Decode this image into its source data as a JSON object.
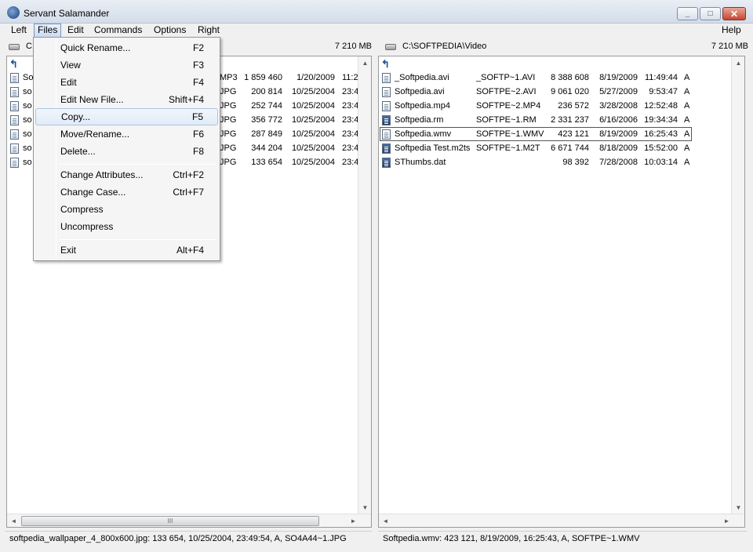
{
  "window": {
    "title": "Servant Salamander"
  },
  "menubar": {
    "items": [
      {
        "label": "Left",
        "name": "menu-left"
      },
      {
        "label": "Files",
        "name": "menu-files"
      },
      {
        "label": "Edit",
        "name": "menu-edit"
      },
      {
        "label": "Commands",
        "name": "menu-commands"
      },
      {
        "label": "Options",
        "name": "menu-options"
      },
      {
        "label": "Right",
        "name": "menu-right"
      },
      {
        "label": "Help",
        "name": "menu-help"
      }
    ]
  },
  "files_menu": {
    "items": [
      {
        "label": "Quick Rename...",
        "shortcut": "F2"
      },
      {
        "label": "View",
        "shortcut": "F3"
      },
      {
        "label": "Edit",
        "shortcut": "F4"
      },
      {
        "label": "Edit New File...",
        "shortcut": "Shift+F4"
      },
      {
        "label": "Copy...",
        "shortcut": "F5"
      },
      {
        "label": "Move/Rename...",
        "shortcut": "F6"
      },
      {
        "label": "Delete...",
        "shortcut": "F8"
      },
      {
        "label": "Change Attributes...",
        "shortcut": "Ctrl+F2"
      },
      {
        "label": "Change Case...",
        "shortcut": "Ctrl+F7"
      },
      {
        "label": "Compress",
        "shortcut": ""
      },
      {
        "label": "Uncompress",
        "shortcut": ""
      },
      {
        "label": "Exit",
        "shortcut": "Alt+F4"
      }
    ]
  },
  "left_panel": {
    "path": "C",
    "free_space": "7 210 MB",
    "status": "softpedia_wallpaper_4_800x600.jpg: 133 654, 10/25/2004, 23:49:54, A, SO4A44~1.JPG",
    "files": [
      {
        "name": "So",
        "ext": "MP3",
        "size": "1 859 460",
        "date": "1/20/2009",
        "time": "11:2"
      },
      {
        "name": "so",
        "ext": "JPG",
        "size": "200 814",
        "date": "10/25/2004",
        "time": "23:4"
      },
      {
        "name": "so",
        "ext": "JPG",
        "size": "252 744",
        "date": "10/25/2004",
        "time": "23:4"
      },
      {
        "name": "so",
        "ext": "JPG",
        "size": "356 772",
        "date": "10/25/2004",
        "time": "23:4"
      },
      {
        "name": "so",
        "ext": "JPG",
        "size": "287 849",
        "date": "10/25/2004",
        "time": "23:4"
      },
      {
        "name": "so",
        "ext": "JPG",
        "size": "344 204",
        "date": "10/25/2004",
        "time": "23:4"
      },
      {
        "name": "so",
        "ext": "JPG",
        "size": "133 654",
        "date": "10/25/2004",
        "time": "23:4"
      }
    ]
  },
  "right_panel": {
    "path": "C:\\SOFTPEDIA\\Video",
    "free_space": "7 210 MB",
    "status": "Softpedia.wmv: 423 121, 8/19/2009, 16:25:43, A, SOFTPE~1.WMV",
    "files": [
      {
        "name": "_Softpedia.avi",
        "dos": "_SOFTP~1.AVI",
        "size": "8 388 608",
        "date": "8/19/2009",
        "time": "11:49:44",
        "attr": "A",
        "icon": "doc"
      },
      {
        "name": "Softpedia.avi",
        "dos": "SOFTPE~2.AVI",
        "size": "9 061 020",
        "date": "5/27/2009",
        "time": "9:53:47",
        "attr": "A",
        "icon": "doc"
      },
      {
        "name": "Softpedia.mp4",
        "dos": "SOFTPE~2.MP4",
        "size": "236 572",
        "date": "3/28/2008",
        "time": "12:52:48",
        "attr": "A",
        "icon": "doc"
      },
      {
        "name": "Softpedia.rm",
        "dos": "SOFTPE~1.RM",
        "size": "2 331 237",
        "date": "6/16/2006",
        "time": "19:34:34",
        "attr": "A",
        "icon": "media"
      },
      {
        "name": "Softpedia.wmv",
        "dos": "SOFTPE~1.WMV",
        "size": "423 121",
        "date": "8/19/2009",
        "time": "16:25:43",
        "attr": "A",
        "icon": "doc"
      },
      {
        "name": "Softpedia Test.m2ts",
        "dos": "SOFTPE~1.M2T",
        "size": "6 671 744",
        "date": "8/18/2009",
        "time": "15:52:00",
        "attr": "A",
        "icon": "media"
      },
      {
        "name": "SThumbs.dat",
        "dos": "",
        "size": "98 392",
        "date": "7/28/2008",
        "time": "10:03:14",
        "attr": "A",
        "icon": "media"
      }
    ]
  },
  "icons": {
    "up_dir": "up-dir-icon",
    "drive": "drive-icon",
    "scroll_up": "▲",
    "scroll_down": "▼",
    "scroll_left": "◄",
    "scroll_right": "►",
    "thumb_grip": "III"
  },
  "colors": {
    "selection_border": "#555555",
    "menu_hover": "#e1ebf8"
  }
}
